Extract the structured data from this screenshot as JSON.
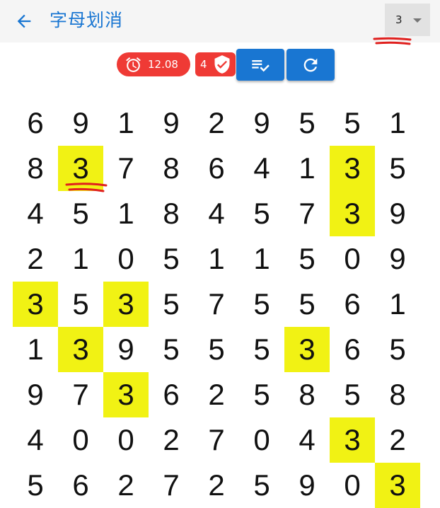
{
  "appbar": {
    "title": "字母划消",
    "back_icon": "arrow-left-icon",
    "dropdown_value": "3"
  },
  "toolbar": {
    "timer": "12.08",
    "found_count": "4",
    "timer_icon": "alarm-clock-icon",
    "count_icon": "shield-check-icon",
    "list_button_icon": "playlist-check-icon",
    "refresh_button_icon": "refresh-icon"
  },
  "colors": {
    "primary": "#1976d2",
    "chip_red": "#ef3a35",
    "highlight": "#f1f214",
    "annotation": "#e0201e"
  },
  "grid": {
    "rows": [
      [
        "6",
        "9",
        "1",
        "9",
        "2",
        "9",
        "5",
        "5",
        "1"
      ],
      [
        "8",
        "3",
        "7",
        "8",
        "6",
        "4",
        "1",
        "3",
        "5"
      ],
      [
        "4",
        "5",
        "1",
        "8",
        "4",
        "5",
        "7",
        "3",
        "9"
      ],
      [
        "2",
        "1",
        "0",
        "5",
        "1",
        "1",
        "5",
        "0",
        "9"
      ],
      [
        "3",
        "5",
        "3",
        "5",
        "7",
        "5",
        "5",
        "6",
        "1"
      ],
      [
        "1",
        "3",
        "9",
        "5",
        "5",
        "5",
        "3",
        "6",
        "5"
      ],
      [
        "9",
        "7",
        "3",
        "6",
        "2",
        "5",
        "8",
        "5",
        "8"
      ],
      [
        "4",
        "0",
        "0",
        "2",
        "7",
        "0",
        "4",
        "3",
        "2"
      ],
      [
        "5",
        "6",
        "2",
        "7",
        "2",
        "5",
        "9",
        "0",
        "3"
      ]
    ],
    "highlighted": [
      [
        1,
        1
      ],
      [
        1,
        7
      ],
      [
        2,
        7
      ],
      [
        4,
        0
      ],
      [
        4,
        2
      ],
      [
        5,
        1
      ],
      [
        5,
        6
      ],
      [
        6,
        2
      ],
      [
        7,
        7
      ],
      [
        8,
        8
      ]
    ]
  }
}
